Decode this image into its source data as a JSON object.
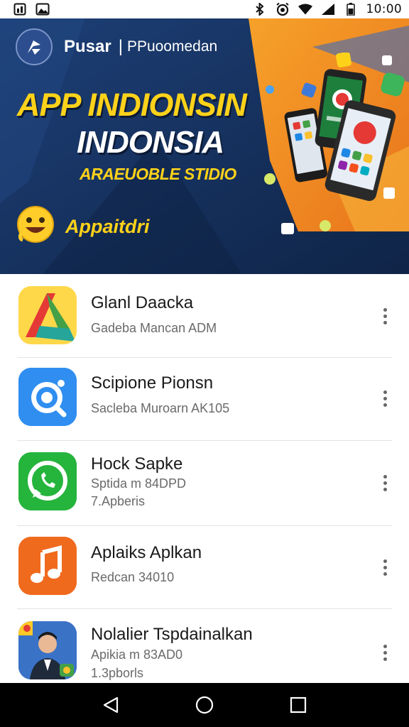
{
  "status_bar": {
    "time": "10:00",
    "icons": [
      "notification-icon",
      "image-icon",
      "bluetooth-icon",
      "alarm-icon",
      "wifi-icon",
      "signal-icon",
      "battery-icon"
    ]
  },
  "banner": {
    "brand": "Pusar",
    "separator": "|",
    "brand_subtitle": "PPuoomedan",
    "title_line1": "APP INDIONSIN",
    "title_line2": "INDONSIA",
    "tagline": "ARAEUOBLE STIDIO",
    "cta": "Appaitdri",
    "colors": {
      "navy": "#17305a",
      "orange": "#f28a1f",
      "yellow": "#ffd21a"
    }
  },
  "apps": [
    {
      "title": "Glanl Daacka",
      "subtitle": "Gadeba Mancan ADM",
      "subtitle2": "",
      "icon": "triangle-app-icon"
    },
    {
      "title": "Scipione Pionsn",
      "subtitle": "Sacleba Muroarn AK105",
      "subtitle2": "",
      "icon": "chat-search-app-icon"
    },
    {
      "title": "Hock Sapke",
      "subtitle": "Sptida m 84DPD",
      "subtitle2": "7.Apberis",
      "icon": "whatsapp-icon"
    },
    {
      "title": "Aplaiks Aplkan",
      "subtitle": "Redcan 34010",
      "subtitle2": "",
      "icon": "music-note-app-icon"
    },
    {
      "title": "Nolalier Tspdainalkan",
      "subtitle": "Apikia m 83AD0",
      "subtitle2": "1.3pborls",
      "icon": "person-photo-app-icon"
    }
  ],
  "nav": {
    "back": "back-icon",
    "home": "home-icon",
    "recents": "recents-icon"
  }
}
